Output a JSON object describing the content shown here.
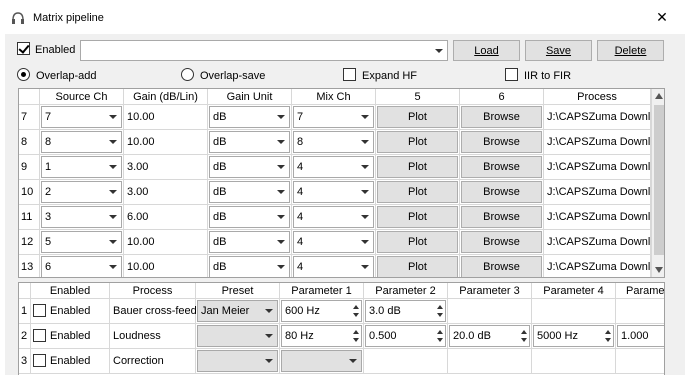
{
  "window": {
    "title": "Matrix pipeline",
    "icon": "headphones-icon",
    "close_glyph": "✕"
  },
  "toolbar": {
    "enabled_label": "Enabled",
    "enabled_checked": true,
    "path_value": "",
    "load_label": "Load",
    "save_label": "Save",
    "delete_label": "Delete"
  },
  "options": {
    "overlap_add_label": "Overlap-add",
    "overlap_add_selected": true,
    "overlap_save_label": "Overlap-save",
    "expand_hf_label": "Expand HF",
    "iir_to_fir_label": "IIR to FIR"
  },
  "matrix": {
    "columns": [
      "Source Ch",
      "Gain (dB/Lin)",
      "Gain Unit",
      "Mix Ch",
      "5",
      "6",
      "Process"
    ],
    "rows": [
      {
        "num": "7",
        "source": "7",
        "gain": "10.00",
        "unit": "dB",
        "mix": "7",
        "plot": "Plot",
        "browse": "Browse",
        "process": "J:\\CAPSZuma Downl..."
      },
      {
        "num": "8",
        "source": "8",
        "gain": "10.00",
        "unit": "dB",
        "mix": "8",
        "plot": "Plot",
        "browse": "Browse",
        "process": "J:\\CAPSZuma Downl..."
      },
      {
        "num": "9",
        "source": "1",
        "gain": "3.00",
        "unit": "dB",
        "mix": "4",
        "plot": "Plot",
        "browse": "Browse",
        "process": "J:\\CAPSZuma Downl..."
      },
      {
        "num": "10",
        "source": "2",
        "gain": "3.00",
        "unit": "dB",
        "mix": "4",
        "plot": "Plot",
        "browse": "Browse",
        "process": "J:\\CAPSZuma Downl..."
      },
      {
        "num": "11",
        "source": "3",
        "gain": "6.00",
        "unit": "dB",
        "mix": "4",
        "plot": "Plot",
        "browse": "Browse",
        "process": "J:\\CAPSZuma Downl..."
      },
      {
        "num": "12",
        "source": "5",
        "gain": "10.00",
        "unit": "dB",
        "mix": "4",
        "plot": "Plot",
        "browse": "Browse",
        "process": "J:\\CAPSZuma Downl..."
      },
      {
        "num": "13",
        "source": "6",
        "gain": "10.00",
        "unit": "dB",
        "mix": "4",
        "plot": "Plot",
        "browse": "Browse",
        "process": "J:\\CAPSZuma Downl..."
      }
    ]
  },
  "processing": {
    "columns": [
      "Enabled",
      "Process",
      "Preset",
      "Parameter 1",
      "Parameter 2",
      "Parameter 3",
      "Parameter 4",
      "Parame"
    ],
    "rows": [
      {
        "num": "1",
        "enabled_label": "Enabled",
        "process": "Bauer cross-feed",
        "preset": "Jan Meier",
        "p1": "600 Hz",
        "p2": "3.0 dB",
        "p3": "",
        "p4": "",
        "p5": ""
      },
      {
        "num": "2",
        "enabled_label": "Enabled",
        "process": "Loudness",
        "preset": "",
        "p1": "80 Hz",
        "p2": "0.500",
        "p3": "20.0 dB",
        "p4": "5000 Hz",
        "p5": "1.000"
      },
      {
        "num": "3",
        "enabled_label": "Enabled",
        "process": "Correction",
        "preset": "",
        "p1": "",
        "p2": "",
        "p3": "",
        "p4": "",
        "p5": ""
      }
    ]
  }
}
